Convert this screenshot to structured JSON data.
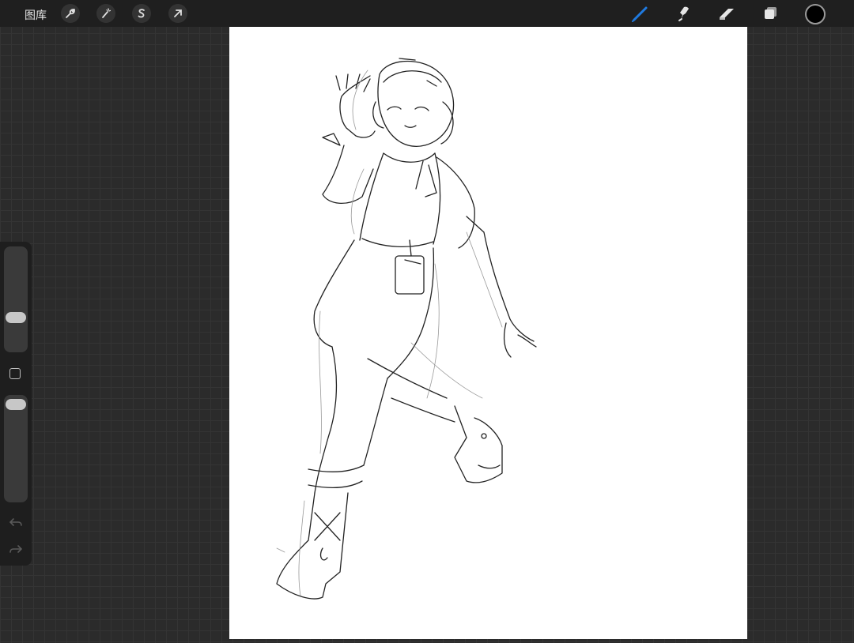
{
  "toolbar": {
    "gallery_label": "图库",
    "left_tools": [
      {
        "name": "actions",
        "icon": "wrench-icon"
      },
      {
        "name": "adjustments",
        "icon": "magic-wand-icon"
      },
      {
        "name": "selection",
        "icon": "selection-s-icon"
      },
      {
        "name": "transform",
        "icon": "arrow-cursor-icon"
      }
    ],
    "right_tools": [
      {
        "name": "brush",
        "icon": "brush-icon",
        "active": true
      },
      {
        "name": "smudge",
        "icon": "smudge-icon"
      },
      {
        "name": "eraser",
        "icon": "eraser-icon"
      },
      {
        "name": "layers",
        "icon": "layers-icon"
      }
    ],
    "current_color": "#000000",
    "accent_color": "#1f7ae0"
  },
  "sidebar": {
    "brush_size_level": 0.38,
    "opacity_level": 1.0,
    "icons": [
      "modify-square-icon",
      "undo-icon",
      "redo-icon"
    ]
  },
  "canvas": {
    "background": "#ffffff",
    "content": "pencil-sketch-figure"
  }
}
